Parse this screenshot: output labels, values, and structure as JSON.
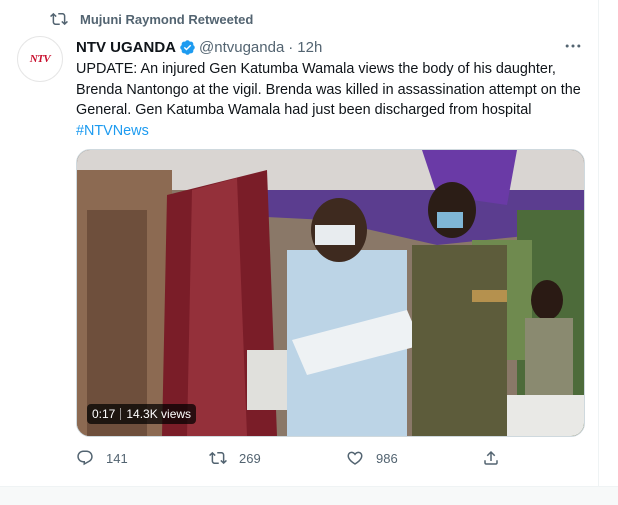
{
  "retweet_header": {
    "text": "Mujuni Raymond Retweeted",
    "icon": "retweet-icon"
  },
  "author": {
    "avatar_text": "NTV",
    "display_name": "NTV UGANDA",
    "verified": true,
    "handle": "@ntvuganda",
    "separator": "·",
    "time": "12h"
  },
  "tweet": {
    "text": "UPDATE: An injured Gen Katumba Wamala views the body of his daughter, Brenda Nantongo at the vigil. Brenda was killed in assassination attempt on the General. Gen Katumba Wamala had just been discharged from hospital",
    "hashtag": "#NTVNews"
  },
  "video": {
    "duration": "0:17",
    "views": "14.3K views"
  },
  "actions": {
    "replies": "141",
    "retweets": "269",
    "likes": "986"
  },
  "colors": {
    "accent": "#1d9bf0",
    "secondary_text": "#536471",
    "primary_text": "#0f1419",
    "verified": "#1d9bf0"
  }
}
